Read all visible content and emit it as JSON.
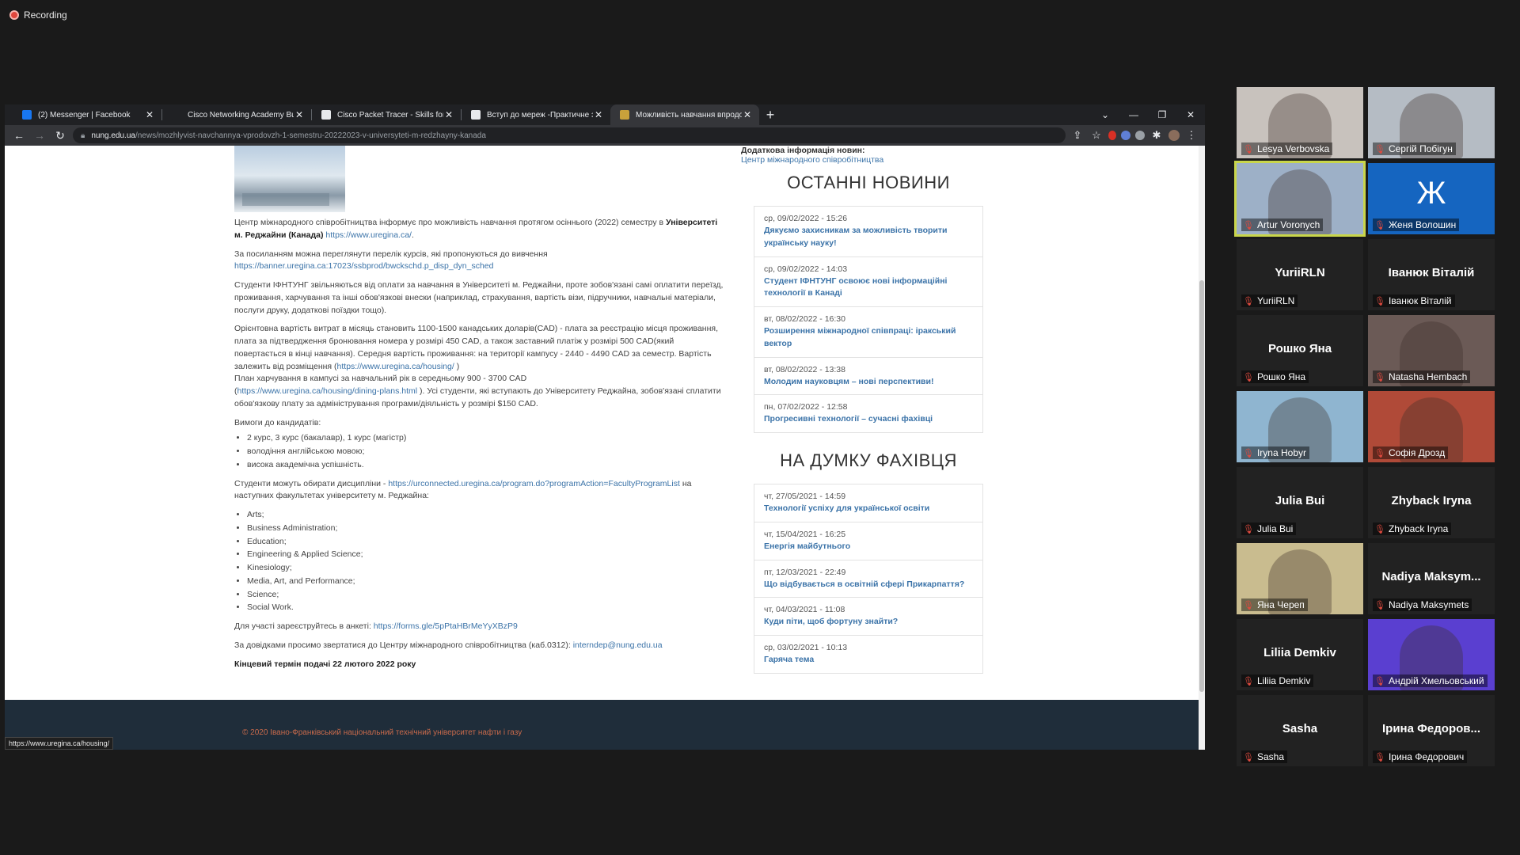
{
  "recording": {
    "label": "Recording"
  },
  "browser": {
    "tabs": [
      {
        "label": "(2) Messenger | Facebook",
        "icon": "facebook-icon",
        "fav_color": "#1877f2",
        "active": false
      },
      {
        "label": "Cisco Networking Academy Build",
        "icon": "cisco-icon",
        "fav_color": "#202124",
        "active": false
      },
      {
        "label": "Cisco Packet Tracer - Skills for All",
        "icon": "page-icon",
        "fav_color": "#e8eaed",
        "active": false
      },
      {
        "label": "Вступ до мереж -Практичне за",
        "icon": "page-icon",
        "fav_color": "#e8eaed",
        "active": false
      },
      {
        "label": "Можливість навчання впродов",
        "icon": "nung-icon",
        "fav_color": "#c9a13b",
        "active": true
      }
    ],
    "new_tab": "+",
    "url_host": "nung.edu.ua",
    "url_path": "/news/mozhlyvist-navchannya-vprodovzh-1-semestru-20222023-v-universyteti-m-redzhayny-kanada",
    "status_link": "https://www.uregina.ca/housing/"
  },
  "article": {
    "p1_a": "Центр міжнародного співробітництва інформує про можливість навчання протягом осіннього (2022) семестру в ",
    "p1_b": "Університеті м. Реджайни (Канада)",
    "p1_link": "https://www.uregina.ca/",
    "p2": "За посиланням можна переглянути перелік курсів, які пропонуються до вивчення",
    "p2_link": "https://banner.uregina.ca:17023/ssbprod/bwckschd.p_disp_dyn_sched",
    "p3": "Студенти ІФНТУНГ звільняються від оплати за навчання в Університеті м. Реджайни, проте зобов'язані самі оплатити переїзд, проживання, харчування та інші обов'язкові внески (наприклад, страхування, вартість візи, підручники, навчальні матеріали, послуги друку, додаткові поїздки тощо).",
    "p4_a": "Орієнтовна вартість витрат в місяць становить 1100-1500 канадських доларів(CAD) -  плата за реєстрацію місця проживання, плата за підтвердження бронювання номера у розмірі 450 CAD, а також заставний платіж у розмірі 500 CAD(який повертається в кінці навчання). Середня вартість проживання: на території кампусу - 2440 - 4490 CAD за семестр. Вартість залежить від розміщення (",
    "p4_link": "https://www.uregina.ca/housing/",
    "p4_b": " )",
    "p4_c": "План харчування в кампусі за навчальний рік  в середньому  900 - 3700 CAD",
    "p4_link2": "https://www.uregina.ca/housing/dining-plans.html",
    "p4_d": " ). Усі студенти, які вступають до Університету Реджайна, зобов'язані сплатити обов'язкову плату за адміністрування програми/діяльність у розмірі $150 CAD.",
    "req_title": "Вимоги до кандидатів:",
    "requirements": [
      "2 курс, 3 курс (бакалавр), 1 курс (магістр)",
      "володіння англійською мовою;",
      "висока академічна успішність."
    ],
    "disc_a": "Студенти можуть обирати дисципліни - ",
    "disc_link": "https://urconnected.uregina.ca/program.do?programAction=FacultyProgramList",
    "disc_b": " на наступних факультетах університету м. Реджайна:",
    "faculties": [
      "Arts;",
      "Business Administration;",
      "Education;",
      "Engineering & Applied Science;",
      "Kinesiology;",
      "Media, Art, and Performance;",
      "Science;",
      "Social Work."
    ],
    "reg_a": "Для участі зареєструйтесь в анкеті:   ",
    "reg_link": "https://forms.gle/5pPtaHBrMeYyXBzP9",
    "contact_a": "За довідками просимо звертатися до Центру міжнародного співробітництва (каб.0312): ",
    "contact_link": "interndep@nung.edu.ua",
    "deadline": "Кінцевий термін подачі 22 лютого 2022 року"
  },
  "sidebar": {
    "addinfo_label": "Додаткова інформація новин:",
    "addinfo_link": "Центр міжнародного співробітництва",
    "latest_title": "ОСТАННІ НОВИНИ",
    "latest": [
      {
        "date": "ср, 09/02/2022 - 15:26",
        "title": "Дякуємо захисникам за можливість творити українську науку!"
      },
      {
        "date": "ср, 09/02/2022 - 14:03",
        "title": "Студент ІФНТУНГ освоює нові інформаційні технології в Канаді"
      },
      {
        "date": "вт, 08/02/2022 - 16:30",
        "title": "Розширення міжнародної співпраці: іракський вектор"
      },
      {
        "date": "вт, 08/02/2022 - 13:38",
        "title": "Молодим науковцям – нові перспективи!"
      },
      {
        "date": "пн, 07/02/2022 - 12:58",
        "title": "Прогресивні технології – сучасні фахівці"
      }
    ],
    "expert_title": "НА ДУМКУ ФАХІВЦЯ",
    "expert": [
      {
        "date": "чт, 27/05/2021 - 14:59",
        "title": "Технології успіху для української освіти"
      },
      {
        "date": "чт, 15/04/2021 - 16:25",
        "title": "Енергія майбутнього"
      },
      {
        "date": "пт, 12/03/2021 - 22:49",
        "title": "Що відбувається в освітній сфері Прикарпаття?"
      },
      {
        "date": "чт, 04/03/2021 - 11:08",
        "title": "Куди піти, щоб фортуну знайти?"
      },
      {
        "date": "ср, 03/02/2021 - 10:13",
        "title": "Гаряча тема"
      }
    ]
  },
  "footer": {
    "text": "© 2020 Івано-Франківський національний технічний університет нафти і газу"
  },
  "participants": [
    {
      "label": "Lesya Verbovska",
      "big": "",
      "video": true,
      "color": "#c8c2bd"
    },
    {
      "label": "Сергій Побігун",
      "big": "",
      "video": true,
      "color": "#b5bcc4"
    },
    {
      "label": "Artur Voronych",
      "big": "",
      "video": true,
      "color": "#9db0c7",
      "speaking": true
    },
    {
      "label": "Женя Волошин",
      "big": "",
      "video": true,
      "color": "#1565c0",
      "initial": "Ж"
    },
    {
      "label": "YuriiRLN",
      "big": "YuriiRLN",
      "video": false
    },
    {
      "label": "Іванюк Віталій",
      "big": "Іванюк Віталій",
      "video": false
    },
    {
      "label": "Рошко Яна",
      "big": "Рошко Яна",
      "video": false
    },
    {
      "label": "Natasha Hembach",
      "big": "",
      "video": true,
      "color": "#6b5a56"
    },
    {
      "label": "Iryna Hobyr",
      "big": "",
      "video": true,
      "color": "#8fb5d0"
    },
    {
      "label": "Софія Дрозд",
      "big": "",
      "video": true,
      "color": "#b04a38"
    },
    {
      "label": "Julia Bui",
      "big": "Julia Bui",
      "video": false
    },
    {
      "label": "Zhyback Iryna",
      "big": "Zhyback Iryna",
      "video": false
    },
    {
      "label": "Яна Череп",
      "big": "",
      "video": true,
      "color": "#c9bc8f"
    },
    {
      "label": "Nadiya Maksymets",
      "big": "Nadiya  Maksym...",
      "video": false
    },
    {
      "label": "Liliia Demkiv",
      "big": "Liliia Demkiv",
      "video": false
    },
    {
      "label": "Андрій Хмельовський",
      "big": "",
      "video": true,
      "color": "#5a3fd0"
    },
    {
      "label": "Sasha",
      "big": "Sasha",
      "video": false
    },
    {
      "label": "Ірина Федорович",
      "big": "Ірина  Федоров...",
      "video": false
    }
  ]
}
